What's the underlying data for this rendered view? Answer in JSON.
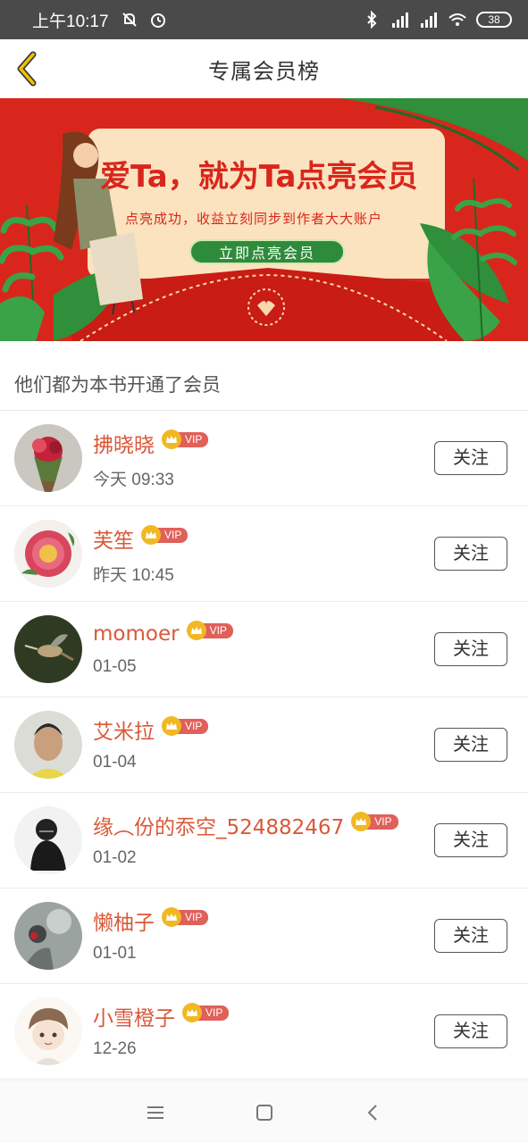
{
  "status_bar": {
    "time": "上午10:17",
    "battery": "38",
    "icons": [
      "mute-icon",
      "alarm-icon",
      "bluetooth-icon",
      "signal-icon",
      "hd-signal-icon",
      "wifi-icon",
      "battery-icon"
    ]
  },
  "header": {
    "title": "专属会员榜",
    "back_icon": "chevron-left-icon",
    "accent_color": "#f2c200"
  },
  "banner": {
    "headline": "爱Ta，就为Ta点亮会员",
    "subtitle": "点亮成功，收益立刻同步到作者大大账户",
    "cta": "立即点亮会员",
    "background_color": "#d9261c"
  },
  "section": {
    "title": "他们都为本书开通了会员"
  },
  "members": [
    {
      "name": "拂晓晓",
      "vip": "VIP",
      "date": "今天 09:33",
      "follow": "关注",
      "avatar": "flower-bouquet"
    },
    {
      "name": "芙笙",
      "vip": "VIP",
      "date": "昨天 10:45",
      "follow": "关注",
      "avatar": "peony"
    },
    {
      "name": "momoer",
      "vip": "VIP",
      "date": "01-05",
      "follow": "关注",
      "avatar": "hummingbird"
    },
    {
      "name": "艾米拉",
      "vip": "VIP",
      "date": "01-04",
      "follow": "关注",
      "avatar": "person-portrait"
    },
    {
      "name": "缘︵份的忝空_524882467",
      "vip": "VIP",
      "date": "01-02",
      "follow": "关注",
      "avatar": "dark-figure"
    },
    {
      "name": "懒柚子",
      "vip": "VIP",
      "date": "01-01",
      "follow": "关注",
      "avatar": "misty-figure"
    },
    {
      "name": "小雪橙子",
      "vip": "VIP",
      "date": "12-26",
      "follow": "关注",
      "avatar": "cartoon-boy"
    }
  ],
  "nav_bar": {
    "icons": [
      "menu-icon",
      "home-square-icon",
      "back-triangle-icon"
    ]
  }
}
